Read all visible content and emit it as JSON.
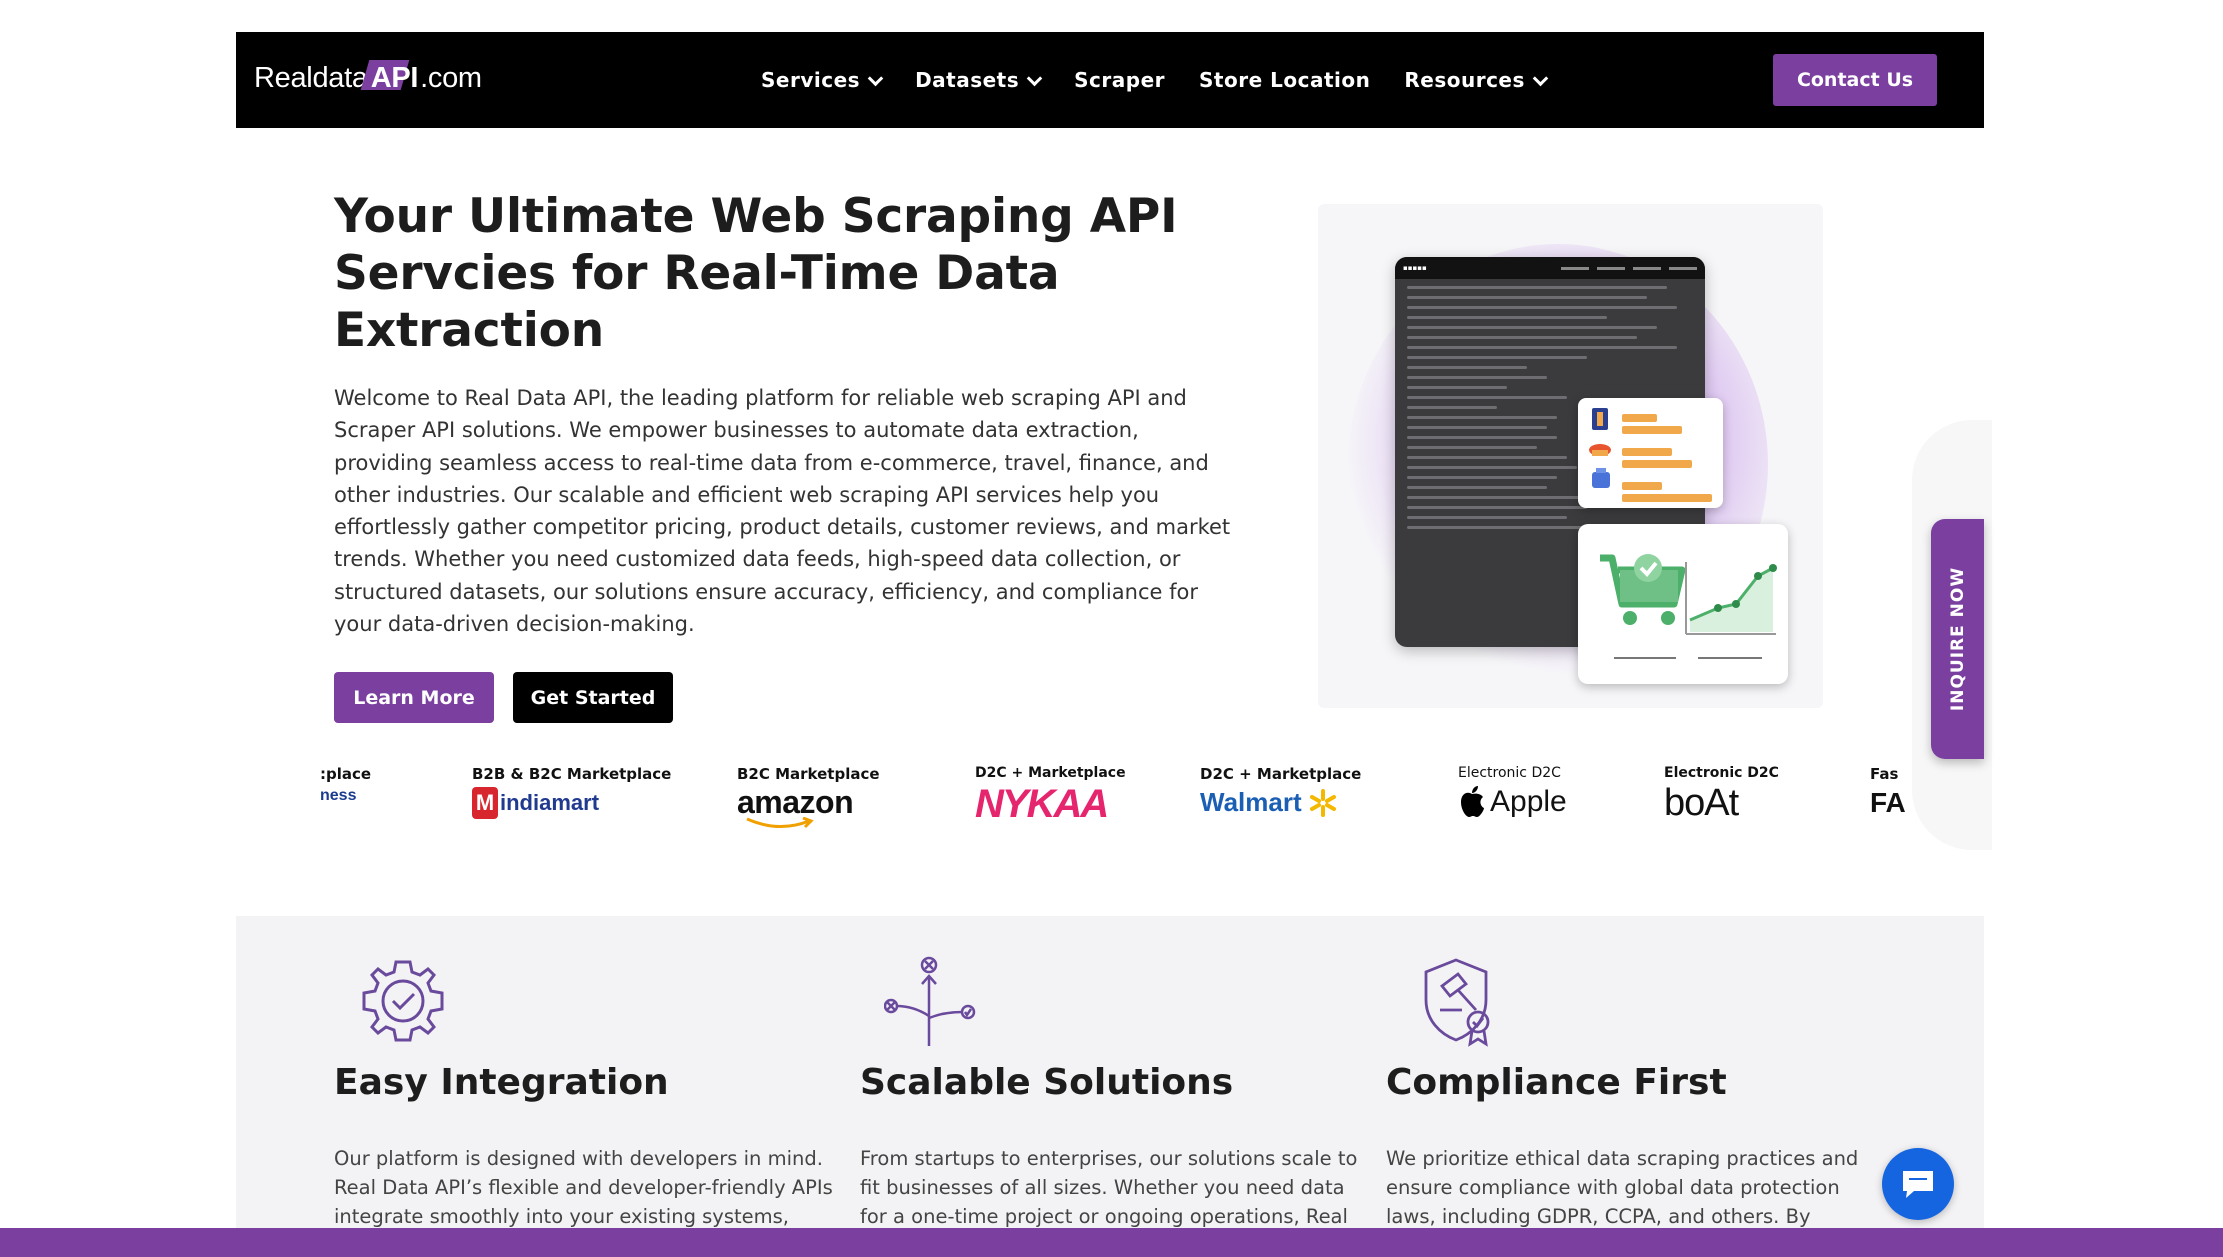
{
  "brand": {
    "name_prefix": "Realdata",
    "name_api": "API",
    "name_suffix": ".com"
  },
  "nav": {
    "items": [
      {
        "label": "Services",
        "dropdown": true
      },
      {
        "label": "Datasets",
        "dropdown": true
      },
      {
        "label": "Scraper",
        "dropdown": false
      },
      {
        "label": "Store Location",
        "dropdown": false
      },
      {
        "label": "Resources",
        "dropdown": true
      }
    ],
    "contact_label": "Contact Us"
  },
  "hero": {
    "title": "Your Ultimate Web Scraping API Servcies for Real-Time Data Extraction",
    "description": "Welcome to Real Data API, the leading platform for reliable web scraping API and Scraper API solutions. We empower businesses to automate data extraction, providing seamless access to real-time data from e-commerce, travel, finance, and other industries. Our scalable and efficient web scraping API services help you effortlessly gather competitor pricing, product details, customer reviews, and market trends. Whether you need customized data feeds, high-speed data collection, or structured datasets, our solutions ensure accuracy, efficiency, and compliance for your data-driven decision-making.",
    "learn_more": "Learn More",
    "get_started": "Get Started"
  },
  "inquire_label": "INQUIRE NOW",
  "marketplaces": [
    {
      "category": ":place",
      "logo": "ness"
    },
    {
      "category": "B2B & B2C Marketplace",
      "logo": "indiamart"
    },
    {
      "category": "B2C Marketplace",
      "logo": "amazon"
    },
    {
      "category": "D2C + Marketplace",
      "logo": "NYKAA"
    },
    {
      "category": "D2C + Marketplace",
      "logo": "Walmart"
    },
    {
      "category": "Electronic D2C",
      "logo": "Apple"
    },
    {
      "category": "Electronic D2C",
      "logo": "boAt"
    },
    {
      "category": "Fas",
      "logo": "FA"
    }
  ],
  "features": [
    {
      "title": "Easy Integration",
      "text": "Our platform is designed with developers in mind. Real Data API’s flexible and developer-friendly APIs integrate smoothly into your existing systems,"
    },
    {
      "title": "Scalable Solutions",
      "text": "From startups to enterprises, our solutions scale to fit businesses of all sizes. Whether you need data for a one-time project or ongoing operations, Real Data"
    },
    {
      "title": "Compliance First",
      "text": "We prioritize ethical data scraping practices and ensure compliance with global data protection laws, including GDPR, CCPA, and others. By"
    }
  ],
  "colors": {
    "accent": "#7b3fa0",
    "nav_bg": "#000000",
    "chat": "#1565e0"
  }
}
